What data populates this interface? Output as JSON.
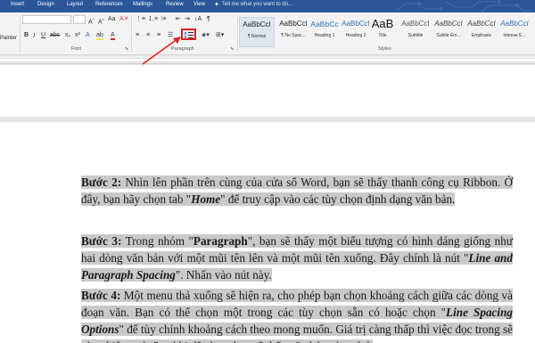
{
  "tabs": [
    "Insert",
    "Design",
    "Layout",
    "References",
    "Mailings",
    "Review",
    "View"
  ],
  "tell_me": "Tell me what you want to do...",
  "ribbon": {
    "clipboard_label": "Painter",
    "font_group_label": "Font",
    "paragraph_group_label": "Paragraph",
    "styles_group_label": "Styles",
    "styles": [
      {
        "sample": "AaBbCcI",
        "name": "¶ Normal"
      },
      {
        "sample": "AaBbCcI",
        "name": "¶ No Spac..."
      },
      {
        "sample": "AaBbCc",
        "name": "Heading 1"
      },
      {
        "sample": "AaBbCcI",
        "name": "Heading 2"
      },
      {
        "sample": "AaB",
        "name": "Title"
      },
      {
        "sample": "AaBbCcI",
        "name": "Subtitle"
      },
      {
        "sample": "AaBbCcI",
        "name": "Subtle Em..."
      },
      {
        "sample": "AaBbCcI",
        "name": "Emphasis"
      },
      {
        "sample": "AaBbCcI",
        "name": "Intense E..."
      }
    ]
  },
  "document": {
    "p2": {
      "label": "Bước 2:",
      "t1": " Nhìn lên phần trên cùng của cửa sổ Word, bạn sẽ thấy thanh công cụ Ribbon. Ở đây, bạn hãy chọn tab \"",
      "em": "Home",
      "t2": "\" để truy cập vào các tùy chọn định dạng văn bản."
    },
    "p3": {
      "label": "Bước 3:",
      "t1": " Trong nhóm \"",
      "strong": "Paragraph",
      "t2": "\", bạn sẽ thấy một biểu tượng có hình dáng giống như hai dòng văn bản với một mũi tên lên và một mũi tên xuống. Đây chính là nút \"",
      "em": "Line and Paragraph Spacing",
      "t3": "\". Nhấn vào nút này."
    },
    "p4": {
      "label": "Bước 4:",
      "t1": " Một menu thả xuống sẽ hiện ra, cho phép bạn chọn khoảng cách giữa các dòng và đoạn văn. Bạn có thể chọn một trong các tùy chọn sẵn có hoặc chọn \"",
      "em": "Line Spacing Options",
      "t2": "\" để tùy chỉnh khoảng cách theo mong muốn. Giá trị càng thấp thì việc đọc trong sẽ càng hiệu quả. Sau khi đã chọn, bạn sẽ thấy văn bản của mình"
    }
  },
  "colors": {
    "tab_bar": "#2b579a",
    "highlight": "#c9c9c9",
    "annotation": "#e02020"
  }
}
